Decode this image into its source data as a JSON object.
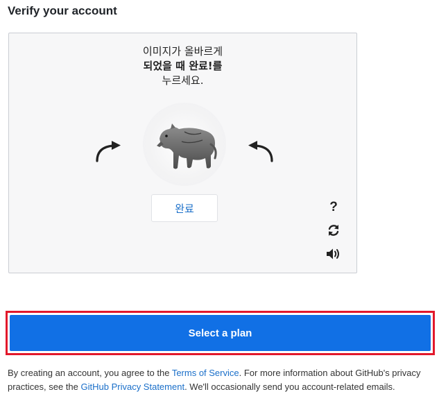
{
  "page": {
    "title": "Verify your account"
  },
  "captcha": {
    "instruction_line1": "이미지가 올바르게",
    "instruction_line2": "되었을 때 완료!를",
    "instruction_line3": "누르세요.",
    "done_label": "완료",
    "help_label": "?",
    "icons": {
      "rotate_left": "curved-arrow-up-right-icon",
      "rotate_right": "curved-arrow-up-left-icon",
      "refresh": "refresh-icon",
      "audio": "speaker-icon",
      "image": "animal-figure-image"
    }
  },
  "actions": {
    "select_plan_label": "Select a plan"
  },
  "legal": {
    "text_1": "By creating an account, you agree to the ",
    "terms_link": "Terms of Service",
    "text_2": ". For more information about GitHub's privacy practices, see the ",
    "privacy_link": "GitHub Privacy Statement",
    "text_3": ". We'll occasionally send you account-related emails."
  },
  "colors": {
    "primary": "#1170e5",
    "highlight": "#e2182b",
    "link": "#1a6fc9"
  }
}
